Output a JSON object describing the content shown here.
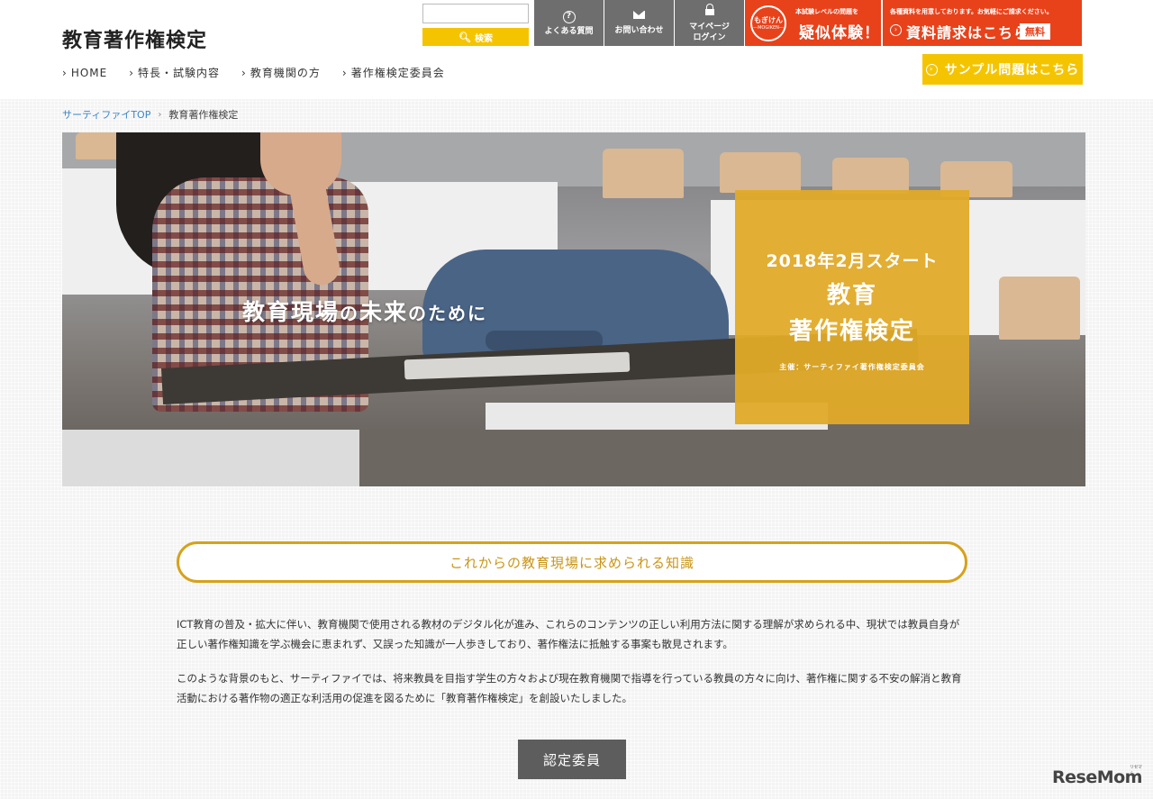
{
  "site": {
    "title": "教育著作権検定"
  },
  "nav": {
    "items": [
      {
        "label": "HOME"
      },
      {
        "label": "特長・試験内容"
      },
      {
        "label": "教育機関の方"
      },
      {
        "label": "著作権検定委員会"
      }
    ]
  },
  "search": {
    "placeholder": "",
    "button_label": "検索"
  },
  "utility": {
    "faq_label": "よくある質問",
    "contact_label": "お問い合わせ",
    "mypage_label_1": "マイページ",
    "mypage_label_2": "ログイン"
  },
  "mogiken": {
    "badge_top": "もぎけん",
    "badge_bottom": "—MOGIKEN—",
    "small": "本試験レベルの問題を",
    "big": "疑似体験！"
  },
  "request": {
    "small": "各種資料を用意しております。お気軽にご請求ください。",
    "big": "資料請求はこちら",
    "free_badge": "無料"
  },
  "sample": {
    "label": "サンプル問題はこちら"
  },
  "breadcrumb": {
    "home": "サーティファイTOP",
    "current": "教育著作権検定"
  },
  "hero": {
    "tagline_1": "教育現場",
    "tagline_2": "の",
    "tagline_3": "未来",
    "tagline_4": "のために",
    "box_line1": "2018年2月スタート",
    "box_line2": "教育",
    "box_line3": "著作権検定",
    "box_line4": "主催：サーティファイ著作権検定委員会"
  },
  "section": {
    "heading": "これからの教育現場に求められる知識",
    "para1": "ICT教育の普及・拡大に伴い、教育機関で使用される教材のデジタル化が進み、これらのコンテンツの正しい利用方法に関する理解が求められる中、現状では教員自身が正しい著作権知識を学ぶ機会に恵まれず、又誤った知識が一人歩きしており、著作権法に抵触する事案も散見されます。",
    "para2": "このような背景のもと、サーティファイでは、将来教員を目指す学生の方々および現在教育機関で指導を行っている教員の方々に向け、著作権に関する不安の解消と教育活動における著作物の適正な利活用の促進を図るために「教育著作権検定」を創設いたしました。",
    "committee_button": "認定委員"
  },
  "watermark": {
    "text": "ReseMom",
    "tag": "リセマム"
  },
  "colors": {
    "accent_yellow": "#f5c400",
    "accent_orange": "#e8421b",
    "gold": "#d6a21b",
    "util_gray": "#6e6e6e"
  }
}
